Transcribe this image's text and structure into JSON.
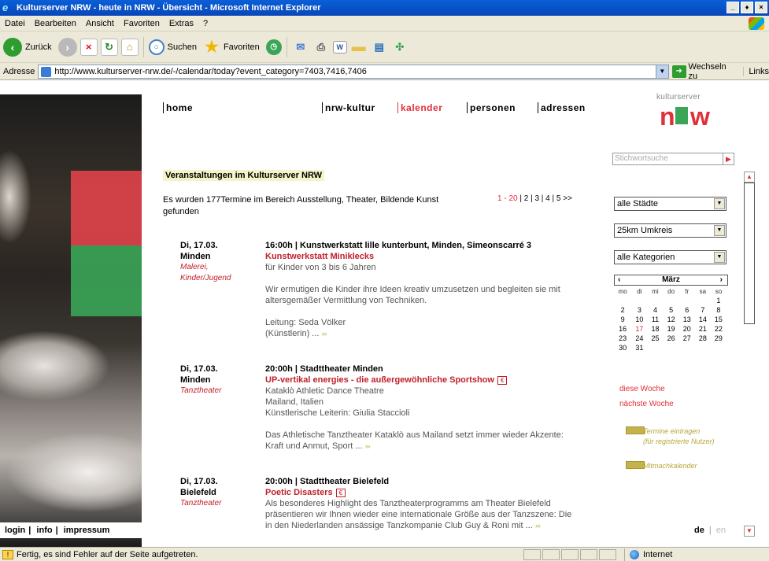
{
  "window": {
    "title": "Kulturserver NRW - heute in NRW - Übersicht - Microsoft Internet Explorer",
    "buttons": [
      "_",
      "♦",
      "×"
    ]
  },
  "menu": [
    "Datei",
    "Bearbeiten",
    "Ansicht",
    "Favoriten",
    "Extras",
    "?"
  ],
  "toolbar": {
    "back": "Zurück",
    "search": "Suchen",
    "favorites": "Favoriten"
  },
  "address": {
    "label": "Adresse",
    "url": "http://www.kulturserver-nrw.de/-/calendar/today?event_category=7403,7416,7406",
    "go": "Wechseln zu",
    "links": "Links"
  },
  "nav": [
    "home",
    "nrw-kultur",
    "kalender",
    "personen",
    "adressen"
  ],
  "logo": {
    "top": "kulturserver",
    "n": "n",
    "w": "w"
  },
  "search_placeholder": "Stichwortsuche",
  "heading": "Veranstaltungen im Kulturserver NRW",
  "result_text": "Es wurden 177Termine im Bereich Ausstellung, Theater, Bildende Kunst gefunden",
  "pager": {
    "current": "1 - 20",
    "rest": "| 2 | 3 | 4 | 5 >>"
  },
  "filters": {
    "city": "alle Städte",
    "radius": "25km Umkreis",
    "category": "alle Kategorien"
  },
  "calendar": {
    "month": "März",
    "prev": "‹",
    "next": "›",
    "days": [
      "mo",
      "di",
      "mi",
      "do",
      "fr",
      "sa",
      "so"
    ],
    "weeks": [
      [
        "",
        "",
        "",
        "",
        "",
        "",
        "1"
      ],
      [
        "2",
        "3",
        "4",
        "5",
        "6",
        "7",
        "8"
      ],
      [
        "9",
        "10",
        "11",
        "12",
        "13",
        "14",
        "15"
      ],
      [
        "16",
        "17",
        "18",
        "19",
        "20",
        "21",
        "22"
      ],
      [
        "23",
        "24",
        "25",
        "26",
        "27",
        "28",
        "29"
      ],
      [
        "30",
        "31",
        "",
        "",
        "",
        "",
        ""
      ]
    ],
    "today": "17"
  },
  "side": {
    "this_week": "diese Woche",
    "next_week": "nächste Woche",
    "add_event": "Termine eintragen",
    "add_event_note": "(für registrierte Nutzer)",
    "mitmach": "Mitmachkalender"
  },
  "events": [
    {
      "date": "Di, 17.03.",
      "city": "Minden",
      "category": "Malerei, Kinder/Jugend",
      "header": "16:00h | Kunstwerkstatt lille kunterbunt, Minden, Simeonscarré 3",
      "title": "Kunstwerkstatt Miniklecks",
      "sub": "für Kinder von 3 bis 6 Jahren",
      "desc": "Wir ermutigen die Kinder ihre Ideen kreativ umzusetzen und begleiten sie mit altersgemäßer Vermittlung von Techniken.",
      "lead": "Leitung: Seda Völker",
      "lead2": "(Künstlerin) ...",
      "more": "›››"
    },
    {
      "date": "Di, 17.03.",
      "city": "Minden",
      "category": "Tanztheater",
      "header": "20:00h | Stadttheater Minden",
      "title": "UP-vertikal energies - die außergewöhnliche Sportshow",
      "euro": "€",
      "line1": "Kataklò Athletic Dance Theatre",
      "line2": "Mailand, Italien",
      "line3": "Künstlerische Leiterin: Giulia Staccioli",
      "desc": "Das Athletische Tanztheater Kataklò aus Mailand setzt immer wieder Akzente: Kraft und Anmut, Sport ...",
      "more": "›››"
    },
    {
      "date": "Di, 17.03.",
      "city": "Bielefeld",
      "category": "Tanztheater",
      "header": "20:00h | Stadttheater Bielefeld",
      "title": "Poetic Disasters",
      "euro": "€",
      "desc": "Als besonderes Highlight des Tanztheaterprogramms am Theater Bielefeld präsentieren wir Ihnen wieder eine internationale Größe aus der Tanzszene: Die in den Niederlanden ansässige Tanzkompanie Club Guy & Roni mit ...",
      "more": "›››"
    }
  ],
  "footer": {
    "login": "login",
    "info": "info",
    "impressum": "impressum"
  },
  "lang": {
    "de": "de",
    "sep": "|",
    "en": "en"
  },
  "status": {
    "text": "Fertig, es sind Fehler auf der Seite aufgetreten.",
    "zone": "Internet"
  }
}
